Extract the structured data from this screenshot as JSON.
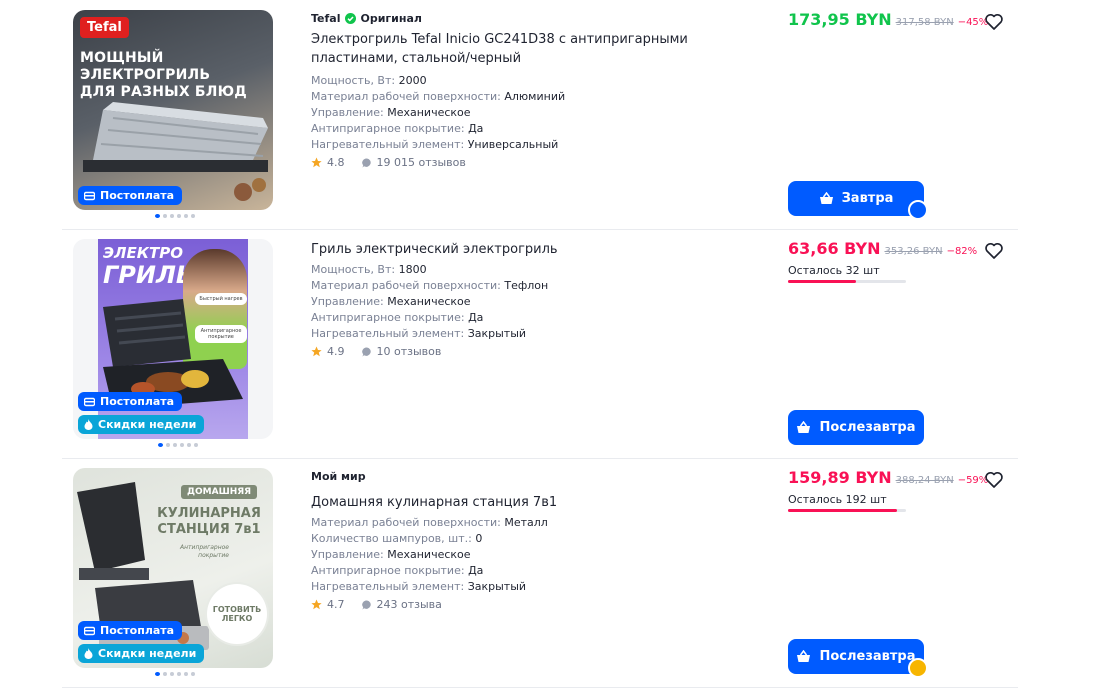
{
  "colors": {
    "accent": "#005bff",
    "price_green": "#10c44c",
    "price_pink": "#f91155",
    "original_check": "#10c44c"
  },
  "products": [
    {
      "image": {
        "brand_logo": "Tefal",
        "headline": [
          "МОЩНЫЙ ЭЛЕКТРОГРИЛЬ",
          "ДЛЯ РАЗНЫХ БЛЮД"
        ],
        "badges": [
          "Постоплата"
        ]
      },
      "brand": "Tefal",
      "original_label": "Оригинал",
      "title": "Электрогриль Tefal Inicio GC241D38 с антипригарными пластинами, стальной/черный",
      "attrs": [
        {
          "label": "Мощность, Вт:",
          "value": "2000"
        },
        {
          "label": "Материал рабочей поверхности:",
          "value": "Алюминий"
        },
        {
          "label": "Управление:",
          "value": "Механическое"
        },
        {
          "label": "Антипригарное покрытие:",
          "value": "Да"
        },
        {
          "label": "Нагревательный элемент:",
          "value": "Универсальный"
        }
      ],
      "rating": "4.8",
      "reviews": "19 015 отзывов",
      "price": "173,95 BYN",
      "old_price": "317,58 BYN",
      "discount": "−45%",
      "cart_button": "Завтра",
      "cart_icon": "basket-icon",
      "button_corner_badge": "ozon"
    },
    {
      "image": {
        "headline": [
          "ЭЛЕКТРО",
          "ГРИЛЬ"
        ],
        "small_labels": [
          "Быстрый нагрев",
          "Антипригарное покрытие"
        ],
        "badges": [
          "Постоплата",
          "Скидки недели"
        ]
      },
      "brand": "",
      "title": "Гриль электрический электрогриль",
      "attrs": [
        {
          "label": "Мощность, Вт:",
          "value": "1800"
        },
        {
          "label": "Материал рабочей поверхности:",
          "value": "Тефлон"
        },
        {
          "label": "Управление:",
          "value": "Механическое"
        },
        {
          "label": "Антипригарное покрытие:",
          "value": "Да"
        },
        {
          "label": "Нагревательный элемент:",
          "value": "Закрытый"
        }
      ],
      "rating": "4.9",
      "reviews": "10 отзывов",
      "price": "63,66 BYN",
      "old_price": "353,26 BYN",
      "discount": "−82%",
      "stock_left": "Осталось 32 шт",
      "stock_fraction": 0.58,
      "cart_button": "Послезавтра",
      "cart_icon": "basket-icon"
    },
    {
      "image": {
        "tag": "ДОМАШНЯЯ",
        "headline": [
          "КУЛИНАРНАЯ",
          "СТАНЦИЯ 7в1"
        ],
        "subline": [
          "Антипригарное",
          "покрытие"
        ],
        "sticker": [
          "ГОТОВИТЬ",
          "ЛЕГКО"
        ],
        "badges": [
          "Постоплата",
          "Скидки недели"
        ]
      },
      "brand": "Мой мир",
      "title": "Домашняя кулинарная станция 7в1",
      "attrs": [
        {
          "label": "Материал рабочей поверхности:",
          "value": "Металл"
        },
        {
          "label": "Количество шампуров, шт.:",
          "value": "0"
        },
        {
          "label": "Управление:",
          "value": "Механическое"
        },
        {
          "label": "Антипригарное покрытие:",
          "value": "Да"
        },
        {
          "label": "Нагревательный элемент:",
          "value": "Закрытый"
        }
      ],
      "rating": "4.7",
      "reviews": "243 отзыва",
      "price": "159,89 BYN",
      "old_price": "388,24 BYN",
      "discount": "−59%",
      "stock_left": "Осталось 192 шт",
      "stock_fraction": 0.92,
      "cart_button": "Послезавтра",
      "cart_icon": "basket-icon",
      "button_corner_badge": "premium"
    }
  ]
}
